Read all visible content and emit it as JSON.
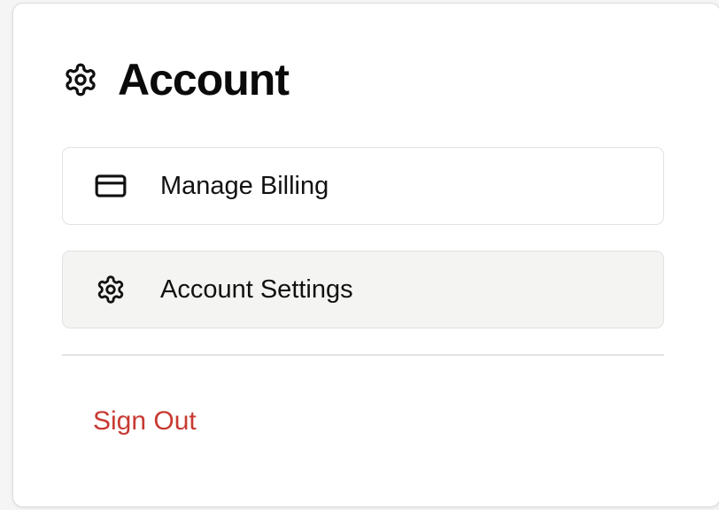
{
  "colors": {
    "card_background": "#ffffff",
    "selected_item_background": "#f4f4f3",
    "sign_out": "#c83a32",
    "text": "#111111"
  },
  "header": {
    "icon": "gear-icon",
    "title": "Account"
  },
  "menu": {
    "items": [
      {
        "icon": "credit-card-icon",
        "label": "Manage Billing"
      },
      {
        "icon": "gear-icon",
        "label": "Account Settings"
      }
    ]
  },
  "footer": {
    "sign_out_label": "Sign Out"
  }
}
